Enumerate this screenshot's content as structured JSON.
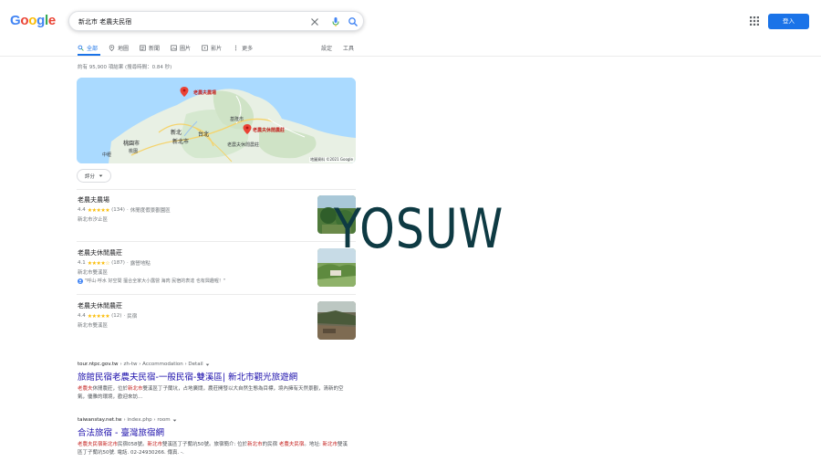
{
  "header": {
    "logo": [
      "G",
      "o",
      "o",
      "g",
      "l",
      "e"
    ],
    "logo_colors": [
      "#4285f4",
      "#ea4335",
      "#fbbc05",
      "#4285f4",
      "#34a853",
      "#ea4335"
    ],
    "query": "新北市 老農夫民宿",
    "signin_label": "登入"
  },
  "tabs": [
    {
      "label": "全部",
      "icon": "search-icon",
      "active": true
    },
    {
      "label": "地圖",
      "icon": "map-pin-icon"
    },
    {
      "label": "新聞",
      "icon": "news-icon"
    },
    {
      "label": "圖片",
      "icon": "image-icon"
    },
    {
      "label": "影片",
      "icon": "video-icon"
    },
    {
      "label": "更多",
      "icon": "more-icon"
    }
  ],
  "tools": {
    "settings": "設定",
    "tools": "工具"
  },
  "stats": "約有 95,900 項結果 (搜尋時間：0.84 秒)",
  "map": {
    "labels": {
      "farm": "老農夫農場",
      "keelung": "基隆市",
      "leisure": "老農夫休閒農莊",
      "leisure2": "老農夫休閒農莊",
      "newtaipei": "新北",
      "taipei": "台北",
      "taoyuan": "桃園市",
      "newtaipei_city": "新北市",
      "zhongli": "中壢",
      "xinzhu": "桃園"
    },
    "copyright": "地圖資料 ©2021 Google"
  },
  "filter": {
    "label": "評分"
  },
  "locals": [
    {
      "name": "老農夫農場",
      "rating": "4.4",
      "stars": "★★★★★",
      "count": "(134)",
      "category": "休閒度假景觀園區",
      "address": "新北市汐止區",
      "review": ""
    },
    {
      "name": "老農夫休閒農莊",
      "rating": "4.1",
      "stars": "★★★★☆",
      "count": "(187)",
      "category": "露營地點",
      "address": "新北市雙溪區",
      "review": "\"呼山·呼水 好空間 擅合全家大小露營 海肉 民宿的表達 也有興趣喔！\""
    },
    {
      "name": "老農夫休閒農莊",
      "rating": "4.4",
      "stars": "★★★★★",
      "count": "(12)",
      "category": "民宿",
      "address": "新北市雙溪區",
      "review": ""
    }
  ],
  "watermark": "YOSUW",
  "web_results": [
    {
      "domain": "tour.ntpc.gov.tw",
      "path": " › zh-tw › Accommodation › Detail",
      "title": "旅館民宿老農夫民宿-一般民宿-雙溪區| 新北市觀光旅遊網",
      "snippet_parts": [
        {
          "text": "老農夫",
          "em": true
        },
        {
          "text": "休閒農莊，位於",
          "em": false
        },
        {
          "text": "新北市",
          "em": true
        },
        {
          "text": "雙溪區丁子蘭坑，占地廣闊，農莊開發以大自然生態為目標，境內擁有天然景觀，清新的空氣，優雅的環境，歡迎來訪…",
          "em": false
        }
      ]
    },
    {
      "domain": "taiwanstay.net.tw",
      "path": " › index.php › room",
      "title": "合法旅宿 - 臺灣旅宿網",
      "snippet_parts": [
        {
          "text": "老農夫民宿新北市",
          "em": true
        },
        {
          "text": "民宿058號。",
          "em": false
        },
        {
          "text": "新北市",
          "em": true
        },
        {
          "text": "雙溪區丁子蘭坑50號。旅宿簡介: 位於",
          "em": false
        },
        {
          "text": "新北市",
          "em": true
        },
        {
          "text": "的民宿 ",
          "em": false
        },
        {
          "text": "老農夫民宿",
          "em": true
        },
        {
          "text": "。地址: ",
          "em": false
        },
        {
          "text": "新北市",
          "em": true
        },
        {
          "text": "雙溪區丁子蘭坑50號. 電話. 02-24930266. 傳真. -.",
          "em": false
        }
      ]
    }
  ]
}
